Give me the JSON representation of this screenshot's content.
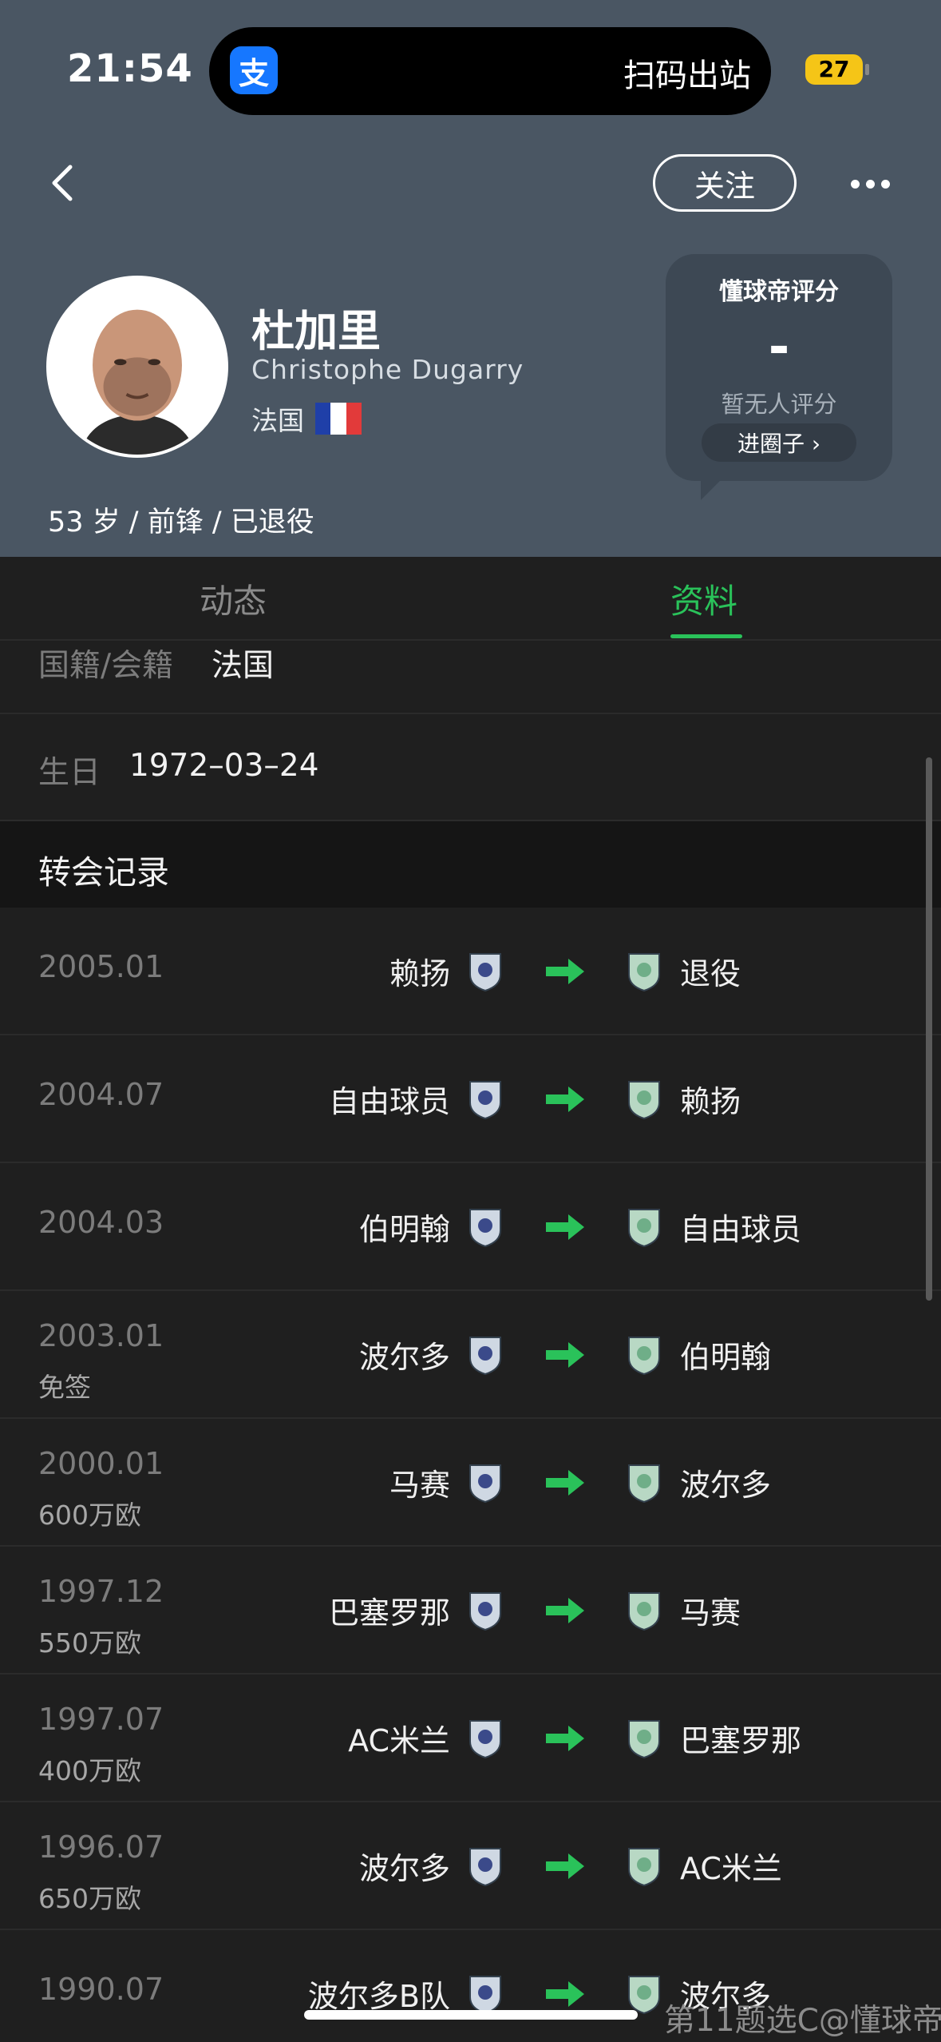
{
  "status_bar": {
    "time": "21:54",
    "alipay_glyph": "支",
    "island_text": "扫码出站",
    "battery": "27"
  },
  "nav": {
    "follow_label": "关注",
    "back_icon": "chevron-left-icon",
    "more_icon": "more-icon"
  },
  "player": {
    "name_cn": "杜加里",
    "name_en": "Christophe Dugarry",
    "nationality": "法国",
    "meta": "53 岁 / 前锋 / 已退役"
  },
  "rating": {
    "title": "懂球帝评分",
    "value": "-",
    "subtitle": "暂无人评分",
    "button": "进圈子 ›"
  },
  "tabs": [
    {
      "label": "动态",
      "active": false
    },
    {
      "label": "资料",
      "active": true
    }
  ],
  "info": {
    "nationality_label": "国籍/会籍",
    "nationality_value": "法国",
    "birthday_label": "生日",
    "birthday_value": "1972–03–24"
  },
  "transfers": {
    "title": "转会记录",
    "rows": [
      {
        "date": "2005.01",
        "fee": "",
        "from": "赖扬",
        "to": "退役"
      },
      {
        "date": "2004.07",
        "fee": "",
        "from": "自由球员",
        "to": "赖扬"
      },
      {
        "date": "2004.03",
        "fee": "",
        "from": "伯明翰",
        "to": "自由球员"
      },
      {
        "date": "2003.01",
        "fee": "免签",
        "from": "波尔多",
        "to": "伯明翰"
      },
      {
        "date": "2000.01",
        "fee": "600万欧",
        "from": "马赛",
        "to": "波尔多"
      },
      {
        "date": "1997.12",
        "fee": "550万欧",
        "from": "巴塞罗那",
        "to": "马赛"
      },
      {
        "date": "1997.07",
        "fee": "400万欧",
        "from": "AC米兰",
        "to": "巴塞罗那"
      },
      {
        "date": "1996.07",
        "fee": "650万欧",
        "from": "波尔多",
        "to": "AC米兰"
      },
      {
        "date": "1990.07",
        "fee": "",
        "from": "波尔多B队",
        "to": "波尔多"
      }
    ]
  },
  "watermark": "第11题选C@懂球帝",
  "colors": {
    "header_bg": "#4a5663",
    "accent_green": "#2ac25a",
    "page_bg": "#1f1f1f"
  }
}
